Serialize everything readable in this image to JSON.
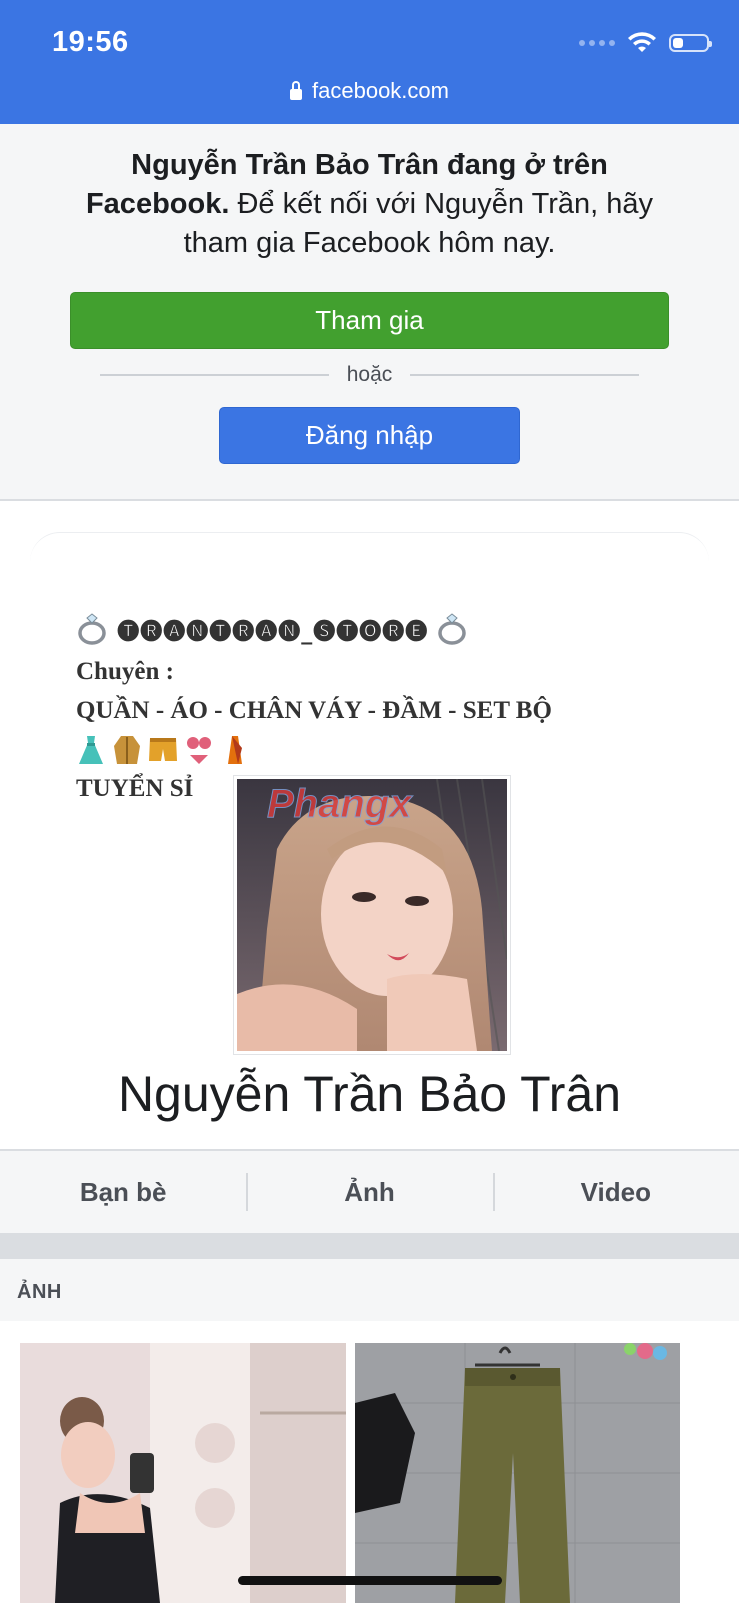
{
  "status_bar": {
    "time": "19:56",
    "battery_level": 0.3
  },
  "browser": {
    "url": "facebook.com"
  },
  "banner": {
    "bold_text": "Nguyễn Trần Bảo Trân đang ở trên Facebook.",
    "text": " Để kết nối với Nguyễn Trần, hãy tham gia Facebook hôm nay.",
    "join_label": "Tham gia",
    "or_label": "hoặc",
    "login_label": "Đăng nhập"
  },
  "profile": {
    "bio_lines": [
      "🅣🅡🅐🅝🅣🅡🅐🅝_🅢🅣🅞🅡🅔",
      "Chuyên :",
      "QUẦN - ÁO - CHÂN VÁY - ĐẦM - SET BỘ",
      "TUYỂN SỈ"
    ],
    "bio_emojis": [
      "dress-emoji",
      "coat-emoji",
      "shorts-emoji",
      "bikini-emoji",
      "sari-emoji"
    ],
    "name": "Nguyễn Trần Bảo Trân",
    "watermark": "Phangx"
  },
  "tabs": [
    {
      "label": "Bạn bè"
    },
    {
      "label": "Ảnh"
    },
    {
      "label": "Video"
    }
  ],
  "photos_section": {
    "title": "ẢNH"
  },
  "colors": {
    "facebook_blue": "#3b75e3",
    "join_green": "#42a02f",
    "background_gray": "#f5f6f7"
  }
}
